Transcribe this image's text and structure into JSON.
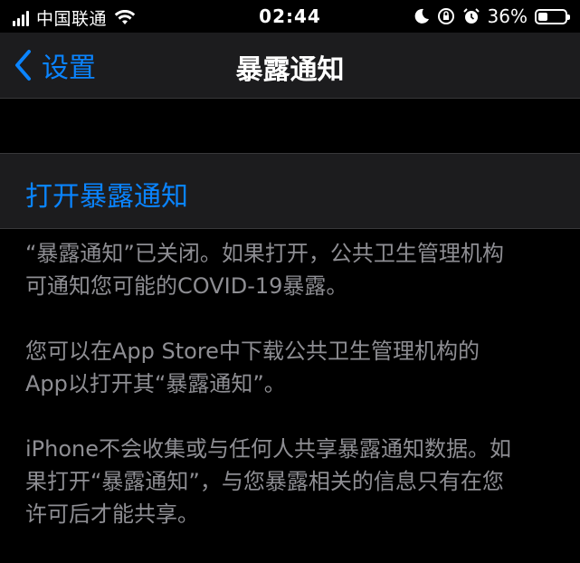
{
  "status_bar": {
    "carrier": "中国联通",
    "time": "02:44",
    "battery_percent": "36%",
    "battery_level": 0.36,
    "icons": [
      "signal-icon",
      "wifi-icon",
      "moon-icon",
      "orientation-lock-icon",
      "alarm-icon",
      "battery-icon"
    ]
  },
  "nav": {
    "back_label": "设置",
    "title": "暴露通知"
  },
  "cell": {
    "label": "打开暴露通知"
  },
  "footer": {
    "paragraphs": [
      "“暴露通知”已关闭。如果打开，公共卫生管理机构\n可通知您可能的COVID-19暴露。",
      "您可以在App Store中下载公共卫生管理机构的\nApp以打开其“暴露通知”。",
      "iPhone不会收集或与任何人共享暴露通知数据。如\n果打开“暴露通知”，与您暴露相关的信息只有在您\n许可后才能共享。"
    ]
  },
  "colors": {
    "accent": "#0a84ff",
    "background": "#000000",
    "cell_background": "#1c1c1e",
    "secondary_text": "#8e8e93"
  }
}
